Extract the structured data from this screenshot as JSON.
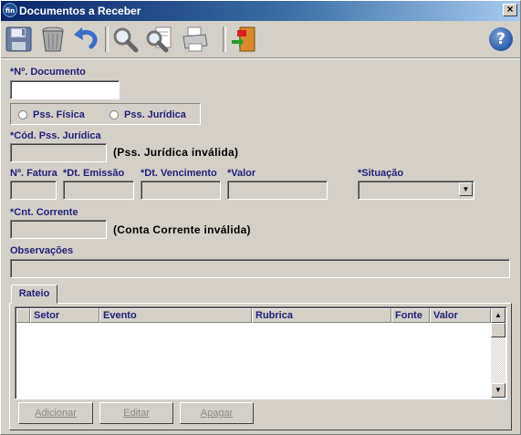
{
  "window": {
    "title": "Documentos a Receber",
    "app_icon_text": "fin",
    "close_label": "×"
  },
  "toolbar": {
    "buttons": [
      {
        "name": "save",
        "icon": "floppy-disk-icon"
      },
      {
        "name": "delete",
        "icon": "trash-can-icon"
      },
      {
        "name": "undo",
        "icon": "undo-arrow-icon"
      },
      {
        "name": "search",
        "icon": "magnifier-icon"
      },
      {
        "name": "search-document",
        "icon": "magnifier-document-icon"
      },
      {
        "name": "print",
        "icon": "printer-icon"
      },
      {
        "name": "exit",
        "icon": "exit-door-icon"
      }
    ],
    "help_label": "?"
  },
  "form": {
    "n_documento_label": "*Nº. Documento",
    "n_documento_value": "",
    "pessoa_fisica_label": "Pss. Física",
    "pessoa_juridica_label": "Pss. Jurídica",
    "cod_pss_juridica_label": "*Cód. Pss. Jurídica",
    "cod_pss_juridica_value": "",
    "pss_juridica_status": "(Pss. Jurídica inválida)",
    "n_fatura_label": "Nº. Fatura",
    "dt_emissao_label": "*Dt. Emissão",
    "dt_vencimento_label": "*Dt. Vencimento",
    "valor_label": "*Valor",
    "situacao_label": "*Situação",
    "situacao_value": "",
    "cnt_corrente_label": "*Cnt. Corrente",
    "conta_corrente_status": "(Conta Corrente inválida)",
    "observacoes_label": "Observações",
    "observacoes_value": ""
  },
  "rateio": {
    "tab_label": "Rateio",
    "columns": [
      "",
      "Setor",
      "Evento",
      "Rubrica",
      "Fonte",
      "Valor"
    ],
    "rows": [],
    "buttons": {
      "adicionar": "Adicionar",
      "editar": "Editar",
      "apagar": "Apagar"
    }
  },
  "colors": {
    "label": "#1f1f7a",
    "title_bar_start": "#0a246a",
    "title_bar_end": "#a6caf0",
    "face": "#d4d0c8"
  }
}
